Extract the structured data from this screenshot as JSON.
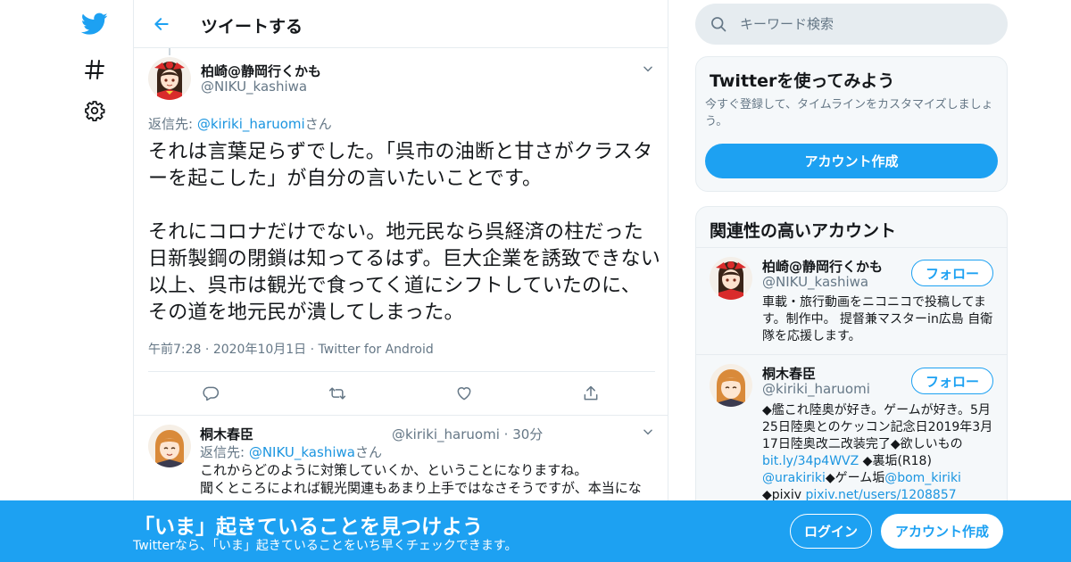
{
  "colors": {
    "accent": "#1da1f2",
    "muted": "#657786",
    "border": "#e6ecf0",
    "panel": "#f5f8fa"
  },
  "nav": {
    "icons": [
      "twitter-bird-icon",
      "hashtag-icon",
      "gear-icon"
    ]
  },
  "header": {
    "title": "ツイートする"
  },
  "tweet": {
    "name": "柏崎@静岡行くかも",
    "handle": "@NIKU_kashiwa",
    "reply_prefix": "返信先: ",
    "reply_to": "@kiriki_haruomi",
    "reply_suffix": "さん",
    "text": "それは言葉足らずでした。「呉市の油断と甘さがクラスターを起こした」が自分の言いたいことです。\n\nそれにコロナだけでない。地元民なら呉経済の柱だった日新製鋼の閉鎖は知ってるはず。巨大企業を誘致できない以上、呉市は観光で食ってく道にシフトしていたのに、その道を地元民が潰してしまった。",
    "time": "午前7:28",
    "date": "2020年10月1日",
    "source": "Twitter for Android"
  },
  "reply": {
    "name": "桐木春臣",
    "handle": "@kiriki_haruomi",
    "age": "30分",
    "reply_prefix": "返信先: ",
    "reply_to": "@NIKU_kashiwa",
    "reply_suffix": "さん",
    "text": "これからどのように対策していくか、ということになりますね。\n聞くところによれば観光関連もあまり上手ではなさそうですが、本当にな"
  },
  "search": {
    "placeholder": "キーワード検索"
  },
  "signup_card": {
    "title": "Twitterを使ってみよう",
    "subtitle": "今すぐ登録して、タイムラインをカスタマイズしましょう。",
    "button": "アカウント作成"
  },
  "related": {
    "title": "関連性の高いアカウント",
    "follow_label": "フォロー",
    "accounts": [
      {
        "name": "柏崎@静岡行くかも",
        "handle": "@NIKU_kashiwa",
        "bio": "車載・旅行動画をニコニコで投稿してます。制作中。 提督兼マスターin広島 自衛隊を応援します。"
      },
      {
        "name": "桐木春臣",
        "handle": "@kiriki_haruomi",
        "bio_parts": {
          "p1": "◆艦これ陸奥が好き。ゲームが好き。5月25日陸奥とのケッコン記念日2019年3月17日陸奥改二改装完了◆欲しいもの",
          "link1": "bit.ly/34p4WVZ",
          "p2": " ◆裏垢(R18)",
          "link2": "@urakiriki",
          "p3": "◆ゲーム垢",
          "link3": "@bom_kiriki",
          "p4": "◆pixiv ",
          "link4": "pixiv.net/users/1208857"
        }
      }
    ]
  },
  "banner": {
    "title": "「いま」起きていることを見つけよう",
    "subtitle": "Twitterなら、「いま」起きていることをいち早くチェックできます。",
    "login": "ログイン",
    "signup": "アカウント作成"
  }
}
